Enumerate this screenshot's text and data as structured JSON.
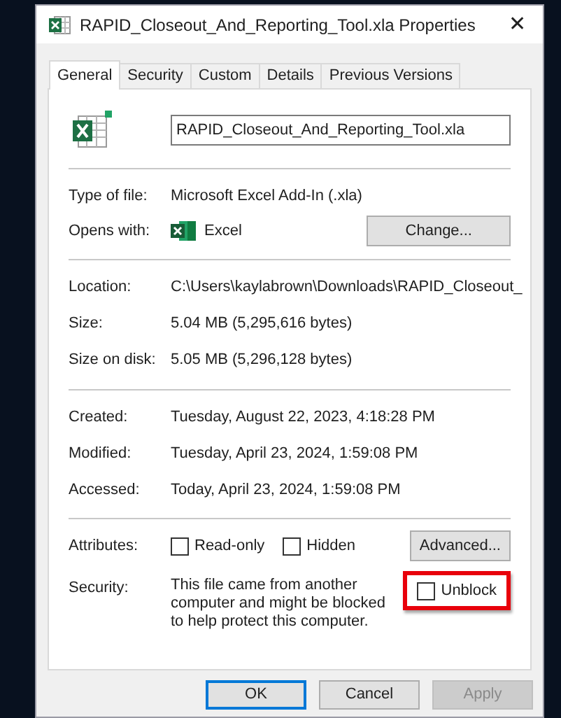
{
  "window": {
    "title": "RAPID_Closeout_And_Reporting_Tool.xla Properties",
    "close": "✕"
  },
  "tabs": [
    {
      "label": "General",
      "selected": true
    },
    {
      "label": "Security",
      "selected": false
    },
    {
      "label": "Custom",
      "selected": false
    },
    {
      "label": "Details",
      "selected": false
    },
    {
      "label": "Previous Versions",
      "selected": false
    }
  ],
  "file_name": {
    "value": "RAPID_Closeout_And_Reporting_Tool.xla"
  },
  "sections": [
    [
      {
        "kind": "text",
        "label": "Type of file:",
        "value": "Microsoft Excel Add-In (.xla)"
      },
      {
        "kind": "app",
        "label": "Opens with:",
        "value": "Excel",
        "button": "Change..."
      }
    ],
    [
      {
        "kind": "text",
        "label": "Location:",
        "value": "C:\\Users\\kaylabrown\\Downloads\\RAPID_Closeout_"
      },
      {
        "kind": "text",
        "label": "Size:",
        "value": "5.04 MB (5,295,616 bytes)"
      },
      {
        "kind": "text",
        "label": "Size on disk:",
        "value": "5.05 MB (5,296,128 bytes)"
      }
    ],
    [
      {
        "kind": "text",
        "label": "Created:",
        "value": "Tuesday, August 22, 2023, 4:18:28 PM"
      },
      {
        "kind": "text",
        "label": "Modified:",
        "value": "Tuesday, April 23, 2024, 1:59:08 PM"
      },
      {
        "kind": "text",
        "label": "Accessed:",
        "value": "Today, April 23, 2024, 1:59:08 PM"
      }
    ]
  ],
  "attributes": {
    "label": "Attributes:",
    "options": [
      {
        "label": "Read-only",
        "checked": false
      },
      {
        "label": "Hidden",
        "checked": false
      }
    ],
    "button": "Advanced..."
  },
  "security": {
    "label": "Security:",
    "text": "This file came from another computer and might be blocked to help protect this computer.",
    "unblock": {
      "label": "Unblock",
      "checked": false,
      "highlighted": true
    }
  },
  "buttons": [
    {
      "label": "OK",
      "default": true,
      "disabled": false
    },
    {
      "label": "Cancel",
      "default": false,
      "disabled": false
    },
    {
      "label": "Apply",
      "default": false,
      "disabled": true
    }
  ]
}
